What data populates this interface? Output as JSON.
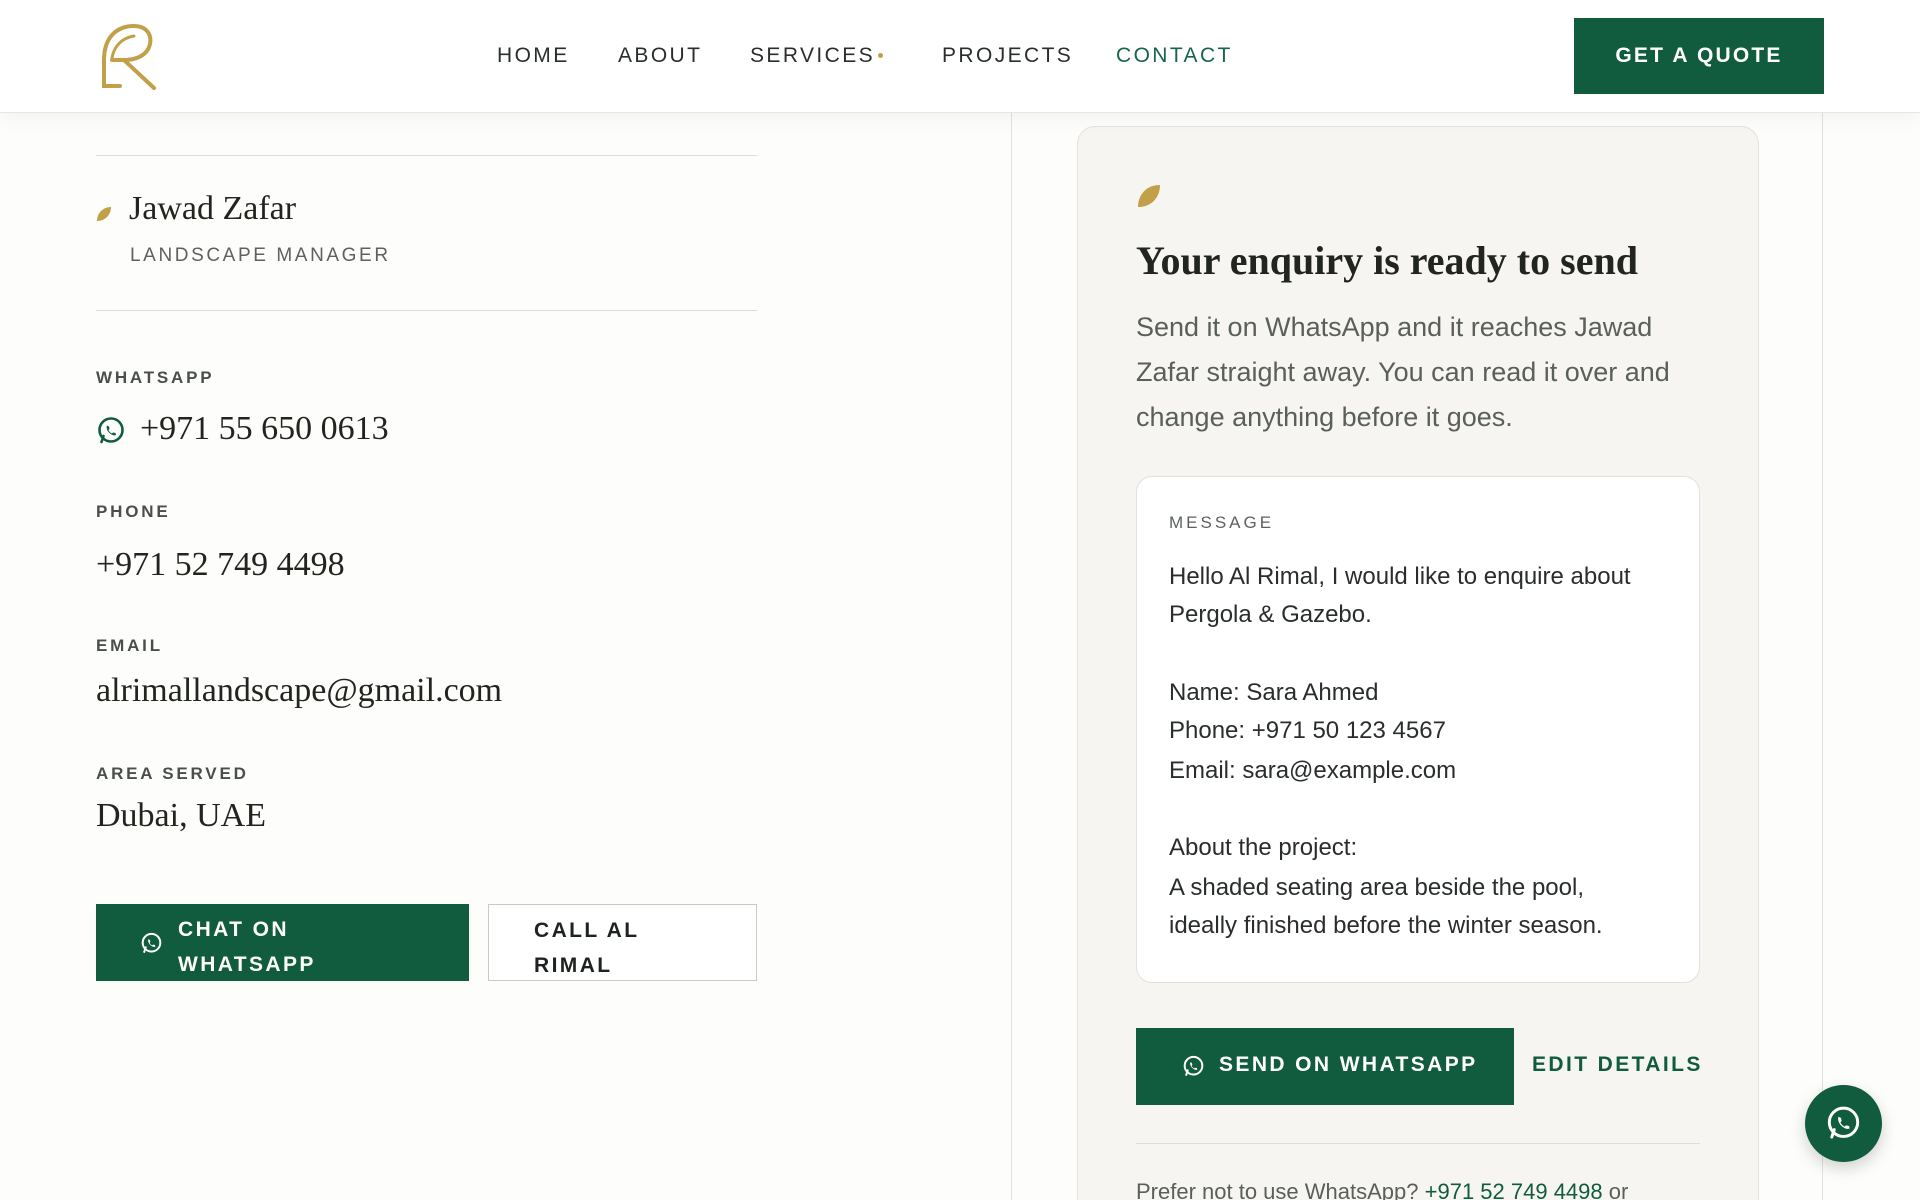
{
  "header": {
    "logo_icon": "al-rimal-r-leaf-logo",
    "nav": [
      {
        "label": "HOME"
      },
      {
        "label": "ABOUT"
      },
      {
        "label": "SERVICES"
      },
      {
        "label": "PROJECTS"
      },
      {
        "label": "CONTACT",
        "active": true
      }
    ],
    "quote_button": "GET A QUOTE"
  },
  "contact": {
    "name": "Jawad Zafar",
    "role": "LANDSCAPE MANAGER",
    "whatsapp_label": "WHATSAPP",
    "whatsapp": "+971 55 650 0613",
    "phone_label": "PHONE",
    "phone": "+971 52 749 4498",
    "email_label": "EMAIL",
    "email": "alrimallandscape@gmail.com",
    "area_label": "AREA SERVED",
    "area": "Dubai, UAE",
    "chat_button": [
      "CHAT ON",
      "WHATSAPP"
    ],
    "call_button": [
      "CALL AL",
      "RIMAL"
    ]
  },
  "enquiry": {
    "title": "Your enquiry is ready to send",
    "description": "Send it on WhatsApp and it reaches Jawad Zafar straight away. You can read it over and change anything before it goes.",
    "message_label": "MESSAGE",
    "message_lines": [
      "Hello Al Rimal, I would like to enquire about",
      "Pergola & Gazebo.",
      "Name: Sara Ahmed",
      "Phone: +971 50 123 4567",
      "Email: sara@example.com",
      "About the project:",
      "A shaded seating area beside the pool,",
      "ideally finished before the winter season."
    ],
    "send_button": "SEND ON WHATSAPP",
    "edit_link": "EDIT DETAILS",
    "footer_prefix": "Prefer not to use WhatsApp?",
    "footer_phone": "+971 52 749 4498",
    "footer_suffix": "or"
  },
  "colors": {
    "brand_green": "#115c3f",
    "accent_gold": "#c2a04a",
    "panel_bg": "#f6f5f1"
  }
}
